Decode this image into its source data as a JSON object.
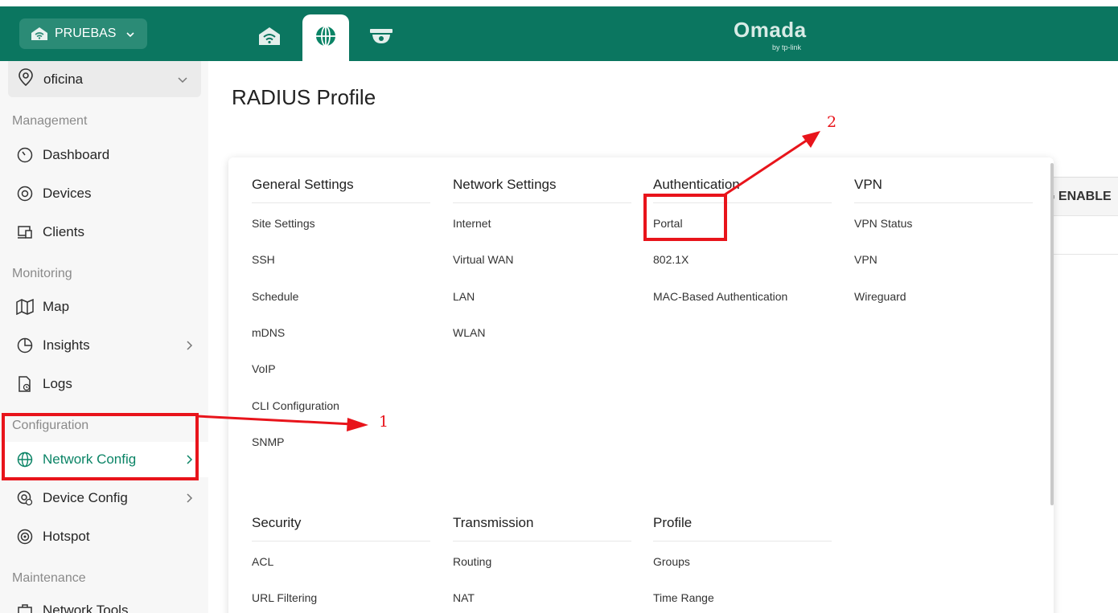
{
  "header": {
    "site_name": "PRUEBAS",
    "brand_name": "Omada",
    "brand_sub": "by tp-link"
  },
  "sidebar": {
    "location": "oficina",
    "sections": {
      "management": "Management",
      "monitoring": "Monitoring",
      "configuration": "Configuration",
      "maintenance": "Maintenance"
    },
    "items": {
      "dashboard": "Dashboard",
      "devices": "Devices",
      "clients": "Clients",
      "map": "Map",
      "insights": "Insights",
      "logs": "Logs",
      "network_config": "Network Config",
      "device_config": "Device Config",
      "hotspot": "Hotspot",
      "network_tools": "Network Tools"
    }
  },
  "main": {
    "title": "RADIUS Profile",
    "behind_header": "G ENABLE"
  },
  "menu": {
    "general": {
      "title": "General Settings",
      "items": [
        "Site Settings",
        "SSH",
        "Schedule",
        "mDNS",
        "VoIP",
        "CLI Configuration",
        "SNMP"
      ]
    },
    "network": {
      "title": "Network Settings",
      "items": [
        "Internet",
        "Virtual WAN",
        "LAN",
        "WLAN"
      ]
    },
    "authentication": {
      "title": "Authentication",
      "items": [
        "Portal",
        "802.1X",
        "MAC-Based Authentication"
      ]
    },
    "vpn": {
      "title": "VPN",
      "items": [
        "VPN Status",
        "VPN",
        "Wireguard"
      ]
    },
    "security": {
      "title": "Security",
      "items": [
        "ACL",
        "URL Filtering"
      ]
    },
    "transmission": {
      "title": "Transmission",
      "items": [
        "Routing",
        "NAT"
      ]
    },
    "profile": {
      "title": "Profile",
      "items": [
        "Groups",
        "Time Range"
      ]
    }
  },
  "annotations": {
    "label_1": "1",
    "label_2": "2",
    "color": "#e8141b"
  },
  "colors": {
    "brand": "#0b7660",
    "active": "#0b8466"
  }
}
